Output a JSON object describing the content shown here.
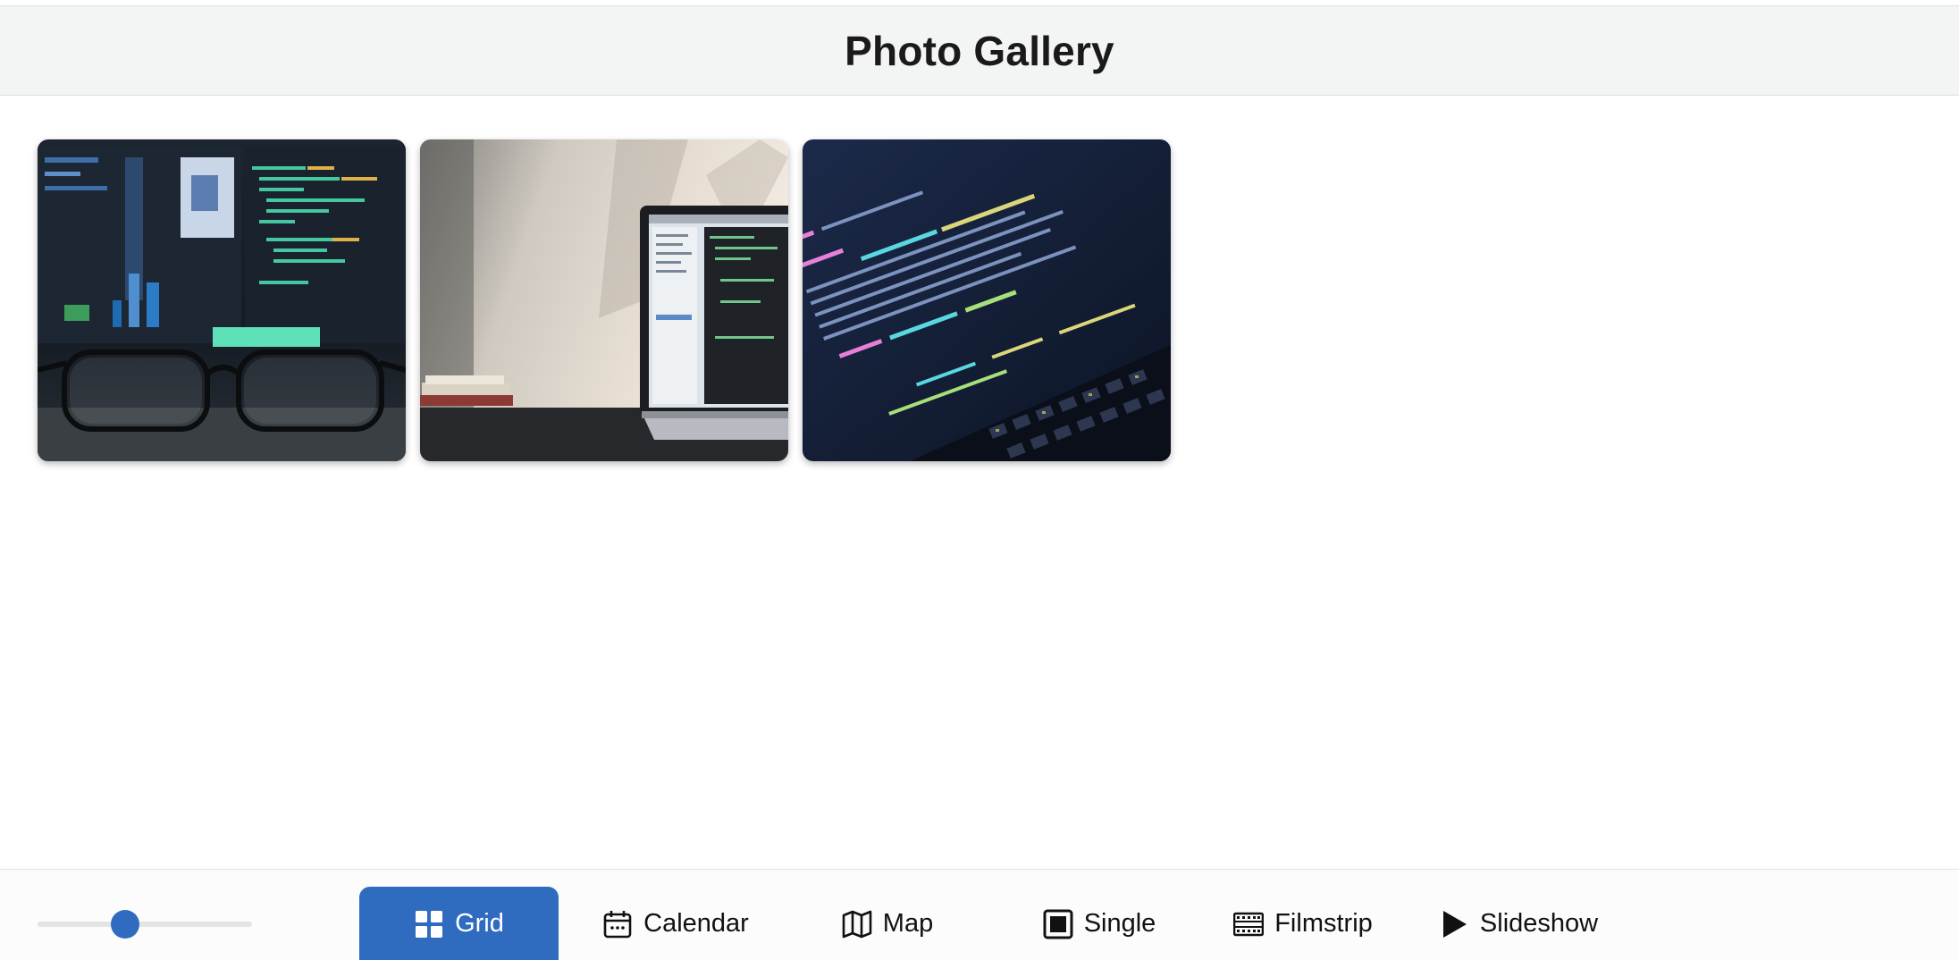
{
  "header": {
    "title": "Photo Gallery"
  },
  "gallery": {
    "photos": [
      {
        "name": "photo-glasses-code",
        "alt": ""
      },
      {
        "name": "photo-laptop-desk",
        "alt": ""
      },
      {
        "name": "photo-code-screen",
        "alt": ""
      }
    ]
  },
  "toolbar": {
    "zoom_level": 0.41,
    "accent_color": "#2f6cc0",
    "views": [
      {
        "label": "Grid",
        "icon": "grid-icon",
        "active": true
      },
      {
        "label": "Calendar",
        "icon": "calendar-icon",
        "active": false
      },
      {
        "label": "Map",
        "icon": "map-icon",
        "active": false
      },
      {
        "label": "Single",
        "icon": "single-icon",
        "active": false
      },
      {
        "label": "Filmstrip",
        "icon": "filmstrip-icon",
        "active": false
      },
      {
        "label": "Slideshow",
        "icon": "play-icon",
        "active": false
      }
    ]
  }
}
